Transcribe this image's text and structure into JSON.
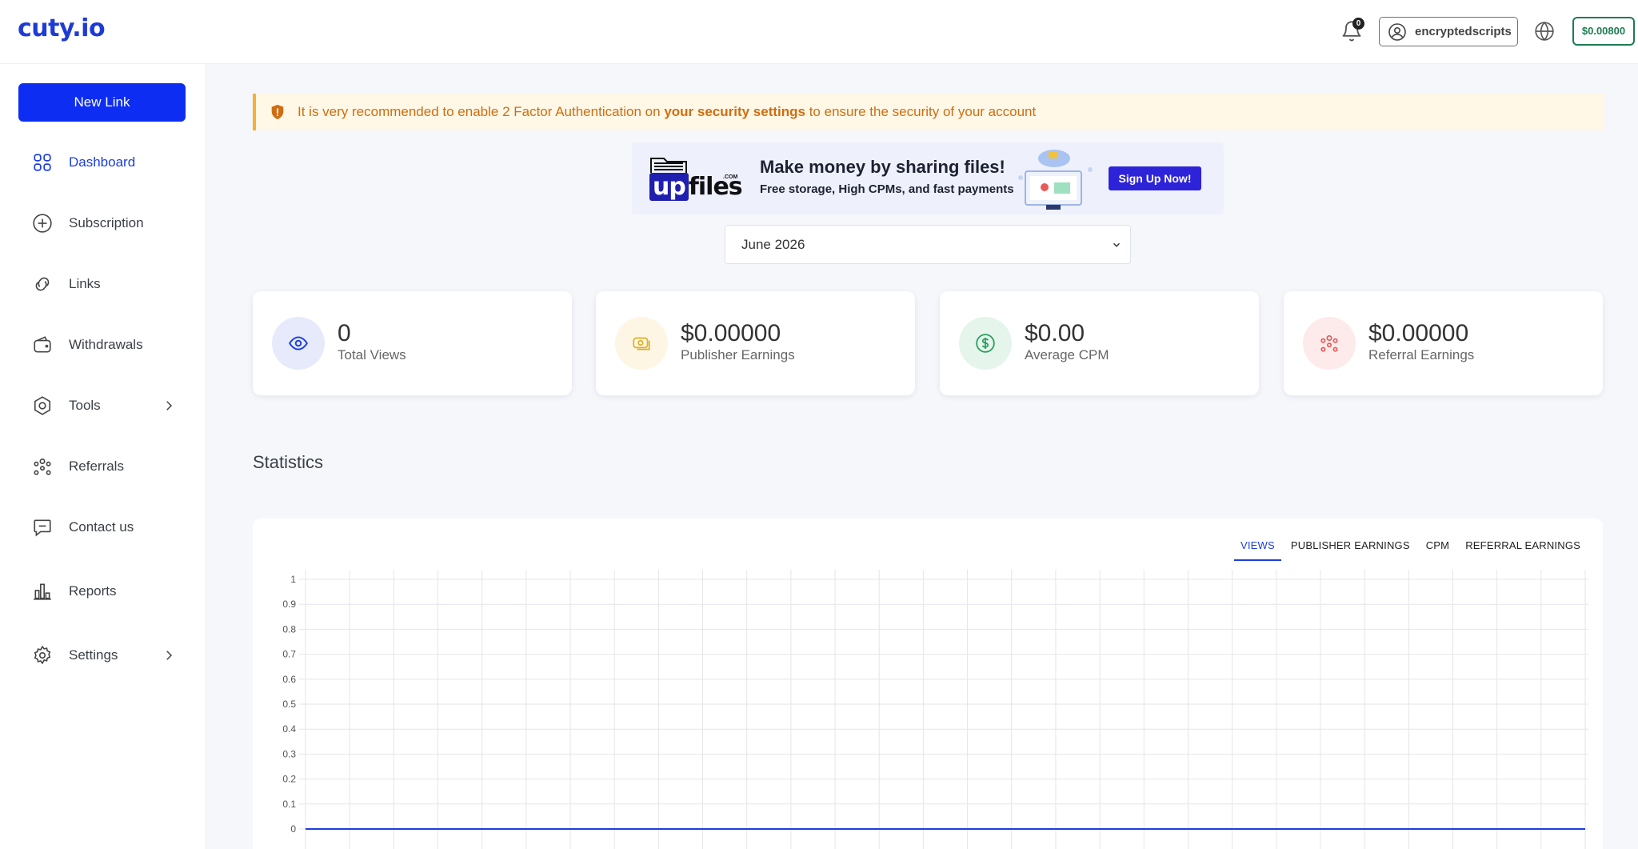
{
  "header": {
    "logo": "cuty.io",
    "notification_count": "0",
    "username": "encryptedscripts",
    "balance": "$0.00800"
  },
  "sidebar": {
    "new_link_label": "New Link",
    "items": [
      {
        "label": "Dashboard",
        "icon": "dashboard-icon",
        "active": true
      },
      {
        "label": "Subscription",
        "icon": "plus-circle-icon"
      },
      {
        "label": "Links",
        "icon": "link-icon"
      },
      {
        "label": "Withdrawals",
        "icon": "wallet-icon"
      },
      {
        "label": "Tools",
        "icon": "tools-icon",
        "has_submenu": true
      },
      {
        "label": "Referrals",
        "icon": "referrals-icon"
      },
      {
        "label": "Contact us",
        "icon": "chat-icon"
      },
      {
        "label": "Reports",
        "icon": "bar-chart-icon"
      },
      {
        "label": "Settings",
        "icon": "gear-icon",
        "has_submenu": true
      }
    ]
  },
  "alert": {
    "text_before": "It is very recommended to enable 2 Factor Authentication on ",
    "link": "your security settings",
    "text_after": " to ensure the security of your account",
    "color": "#cf6d12"
  },
  "banner": {
    "brand_up": "up",
    "brand_files": "files",
    "brand_tld": ".COM",
    "headline": "Make money by sharing files!",
    "subline": "Free storage, High CPMs, and fast payments",
    "cta": "Sign Up Now!"
  },
  "month_select": {
    "value": "June 2026"
  },
  "cards": [
    {
      "value": "0",
      "label": "Total Views",
      "icon": "eye-icon",
      "color": "#1c3ee0",
      "bg": "#e6eafb"
    },
    {
      "value": "$0.00000",
      "label": "Publisher Earnings",
      "icon": "money-icon",
      "color": "#e0b026",
      "bg": "#fdf6e4"
    },
    {
      "value": "$0.00",
      "label": "Average CPM",
      "icon": "dollar-circle-icon",
      "color": "#239d5a",
      "bg": "#e5f5ec"
    },
    {
      "value": "$0.00000",
      "label": "Referral Earnings",
      "icon": "referrals-icon",
      "color": "#e05a5a",
      "bg": "#fdeaea"
    }
  ],
  "statistics": {
    "title": "Statistics",
    "tabs": [
      "VIEWS",
      "PUBLISHER EARNINGS",
      "CPM",
      "REFERRAL EARNINGS"
    ],
    "active_tab": "VIEWS"
  },
  "chart_data": {
    "type": "line",
    "title": "",
    "xlabel": "",
    "ylabel": "",
    "ylim": [
      0,
      1
    ],
    "yticks": [
      "1",
      "0.9",
      "0.8",
      "0.7",
      "0.6",
      "0.5",
      "0.4",
      "0.3",
      "0.2",
      "0.1",
      "0"
    ],
    "x_count": 30,
    "series": [
      {
        "values": [
          0,
          0,
          0,
          0,
          0,
          0,
          0,
          0,
          0,
          0,
          0,
          0,
          0,
          0,
          0,
          0,
          0,
          0,
          0,
          0,
          0,
          0,
          0,
          0,
          0,
          0,
          0,
          0,
          0,
          0
        ]
      }
    ],
    "grid": true,
    "line_color": "#1c3ee0"
  }
}
